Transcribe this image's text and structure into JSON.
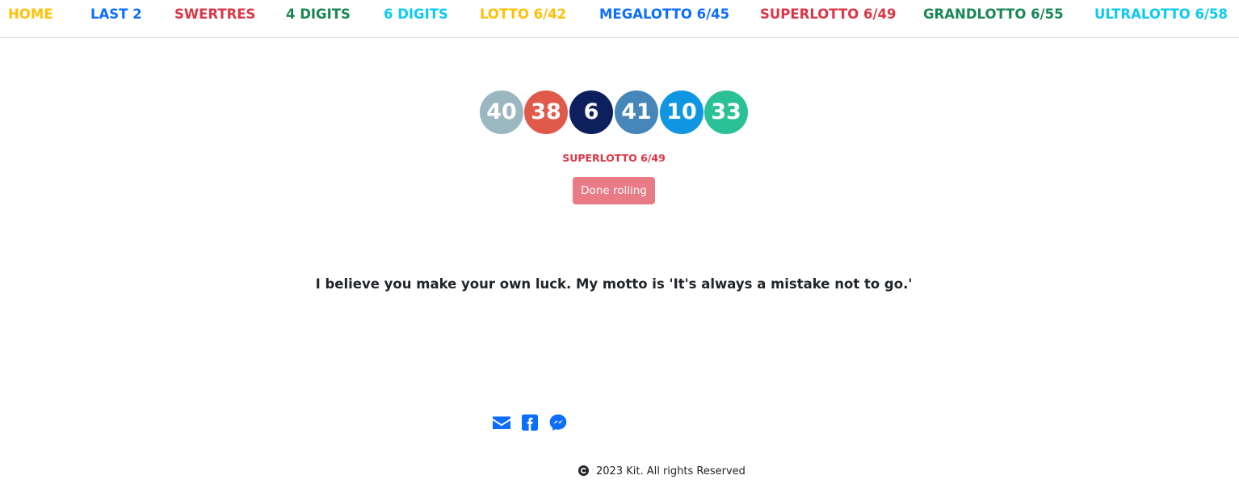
{
  "nav": {
    "items": [
      {
        "label": "HOME",
        "color": "#ffc107"
      },
      {
        "label": "LAST 2",
        "color": "#0d6efd"
      },
      {
        "label": "SWERTRES",
        "color": "#dc3545"
      },
      {
        "label": "4 DIGITS",
        "color": "#198754"
      },
      {
        "label": "6 DIGITS",
        "color": "#0dcaf0"
      },
      {
        "label": "LOTTO 6/42",
        "color": "#ffc107"
      },
      {
        "label": "MEGALOTTO 6/45",
        "color": "#0d6efd"
      },
      {
        "label": "SUPERLOTTO 6/49",
        "color": "#dc3545"
      },
      {
        "label": "GRANDLOTTO 6/55",
        "color": "#198754"
      },
      {
        "label": "ULTRALOTTO 6/58",
        "color": "#0dcaf0"
      }
    ]
  },
  "balls": [
    {
      "number": "40",
      "color": "#9bb7c0"
    },
    {
      "number": "38",
      "color": "#e05a4b"
    },
    {
      "number": "6",
      "color": "#0d1f5c"
    },
    {
      "number": "41",
      "color": "#4686b8"
    },
    {
      "number": "10",
      "color": "#0f96e3"
    },
    {
      "number": "33",
      "color": "#2bc197"
    }
  ],
  "game": {
    "label": "SUPERLOTTO 6/49",
    "color": "#dc3545"
  },
  "roll_button": {
    "label": "Done rolling",
    "color": "#dc3545"
  },
  "quote": "I believe you make your own luck. My motto is 'It's always a mistake not to go.'",
  "social": {
    "icons": [
      "envelope-icon",
      "facebook-icon",
      "messenger-icon"
    ],
    "color": "#0d6efd"
  },
  "footer": {
    "text": "2023 Kit. All rights Reserved"
  }
}
